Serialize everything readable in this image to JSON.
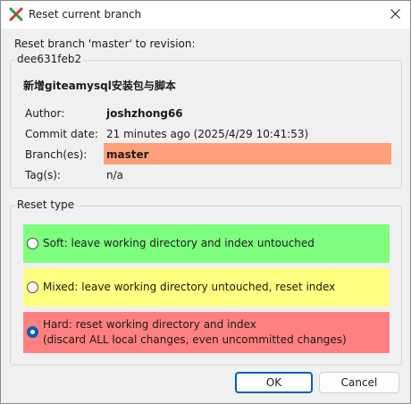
{
  "window": {
    "title": "Reset current branch",
    "close_glyph": "✕"
  },
  "header": {
    "prompt": "Reset branch 'master' to revision:"
  },
  "revision": {
    "hash": "dee631feb2",
    "message": "新增giteamysql安装包与脚本",
    "author_label": "Author:",
    "author": "joshzhong66",
    "commit_date_label": "Commit date:",
    "commit_date": "21 minutes ago (2025/4/29 10:41:53)",
    "branches_label": "Branch(es):",
    "branches": "master",
    "tags_label": "Tag(s):",
    "tags": "n/a"
  },
  "reset_type": {
    "legend": "Reset type",
    "options": [
      {
        "label": "Soft: leave working directory and index untouched",
        "selected": false,
        "color": "#7dff7d"
      },
      {
        "label": "Mixed: leave working directory untouched, reset index",
        "selected": false,
        "color": "#ffff80"
      },
      {
        "label": "Hard: reset working directory and index",
        "label_line2": "(discard ALL local changes, even uncommitted changes)",
        "selected": true,
        "color": "#ff8080"
      }
    ]
  },
  "buttons": {
    "ok": "OK",
    "cancel": "Cancel"
  },
  "colors": {
    "branch_highlight": "#ffa07a",
    "accent": "#005fb8"
  }
}
